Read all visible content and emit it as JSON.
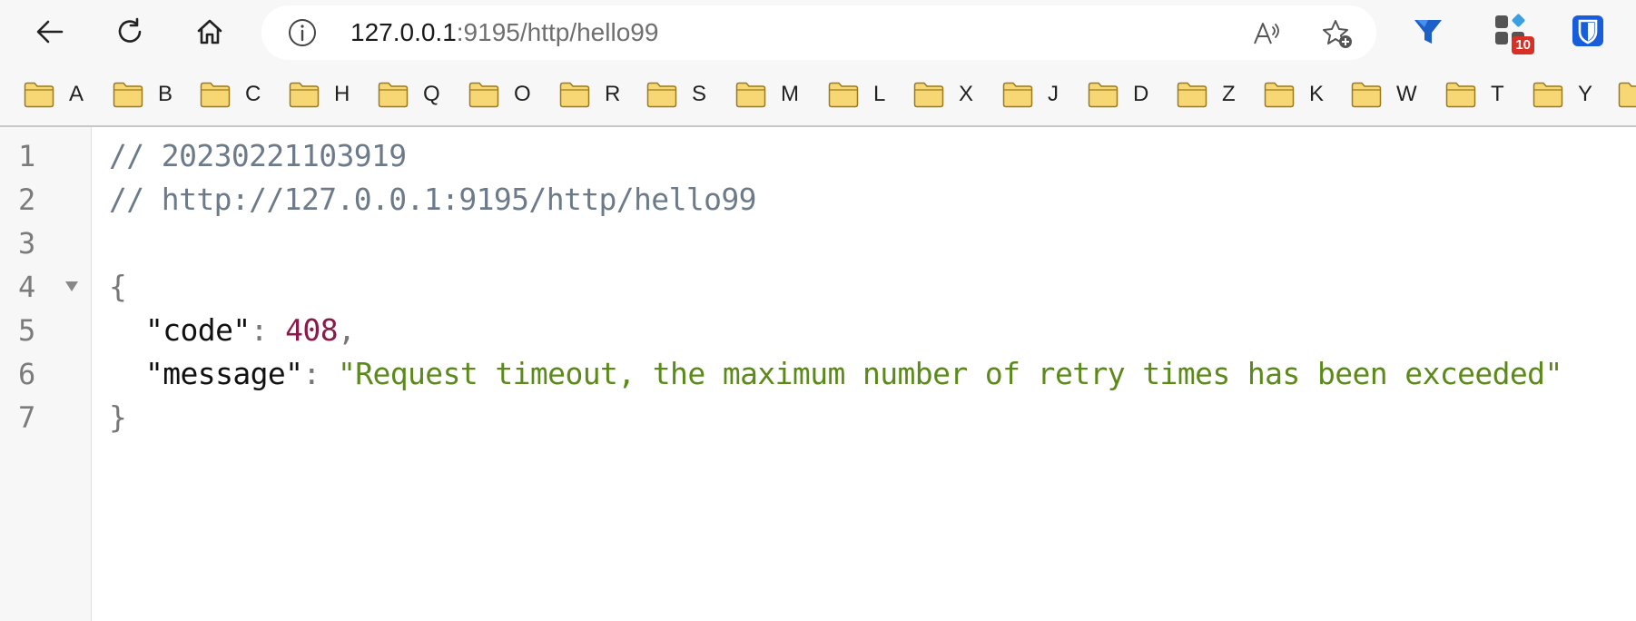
{
  "browser": {
    "url_host": "127.0.0.1",
    "url_rest": ":9195/http/hello99",
    "extension_badge": "10"
  },
  "bookmarks": [
    "A",
    "B",
    "C",
    "H",
    "Q",
    "O",
    "R",
    "S",
    "M",
    "L",
    "X",
    "J",
    "D",
    "Z",
    "K",
    "W",
    "T",
    "Y"
  ],
  "code": {
    "line_numbers": [
      "1",
      "2",
      "3",
      "4",
      "5",
      "6",
      "7"
    ],
    "comment_timestamp": "// 20230221103919",
    "comment_url": "// http://127.0.0.1:9195/http/hello99",
    "open_brace": "{",
    "close_brace": "}",
    "code_key": "\"code\"",
    "code_value": "408",
    "message_key": "\"message\"",
    "message_value": "\"Request timeout, the maximum number of retry times has been exceeded\"",
    "colon": ": ",
    "comma": ","
  },
  "colors": {
    "comment": "#6c7a89",
    "number": "#8a1a4a",
    "string": "#5c8a1a",
    "badge": "#d93025",
    "folder": "#f7d774"
  },
  "icons": {
    "back": "back-arrow-icon",
    "reload": "reload-icon",
    "home": "home-icon",
    "info": "info-icon",
    "read_aloud": "read-aloud-icon",
    "favorite": "add-favorite-icon",
    "extension_1": "funnel-extension-icon",
    "extension_2": "extensions-grid-icon",
    "extension_3": "bitwarden-shield-icon",
    "bookmark_folder": "folder-icon"
  }
}
